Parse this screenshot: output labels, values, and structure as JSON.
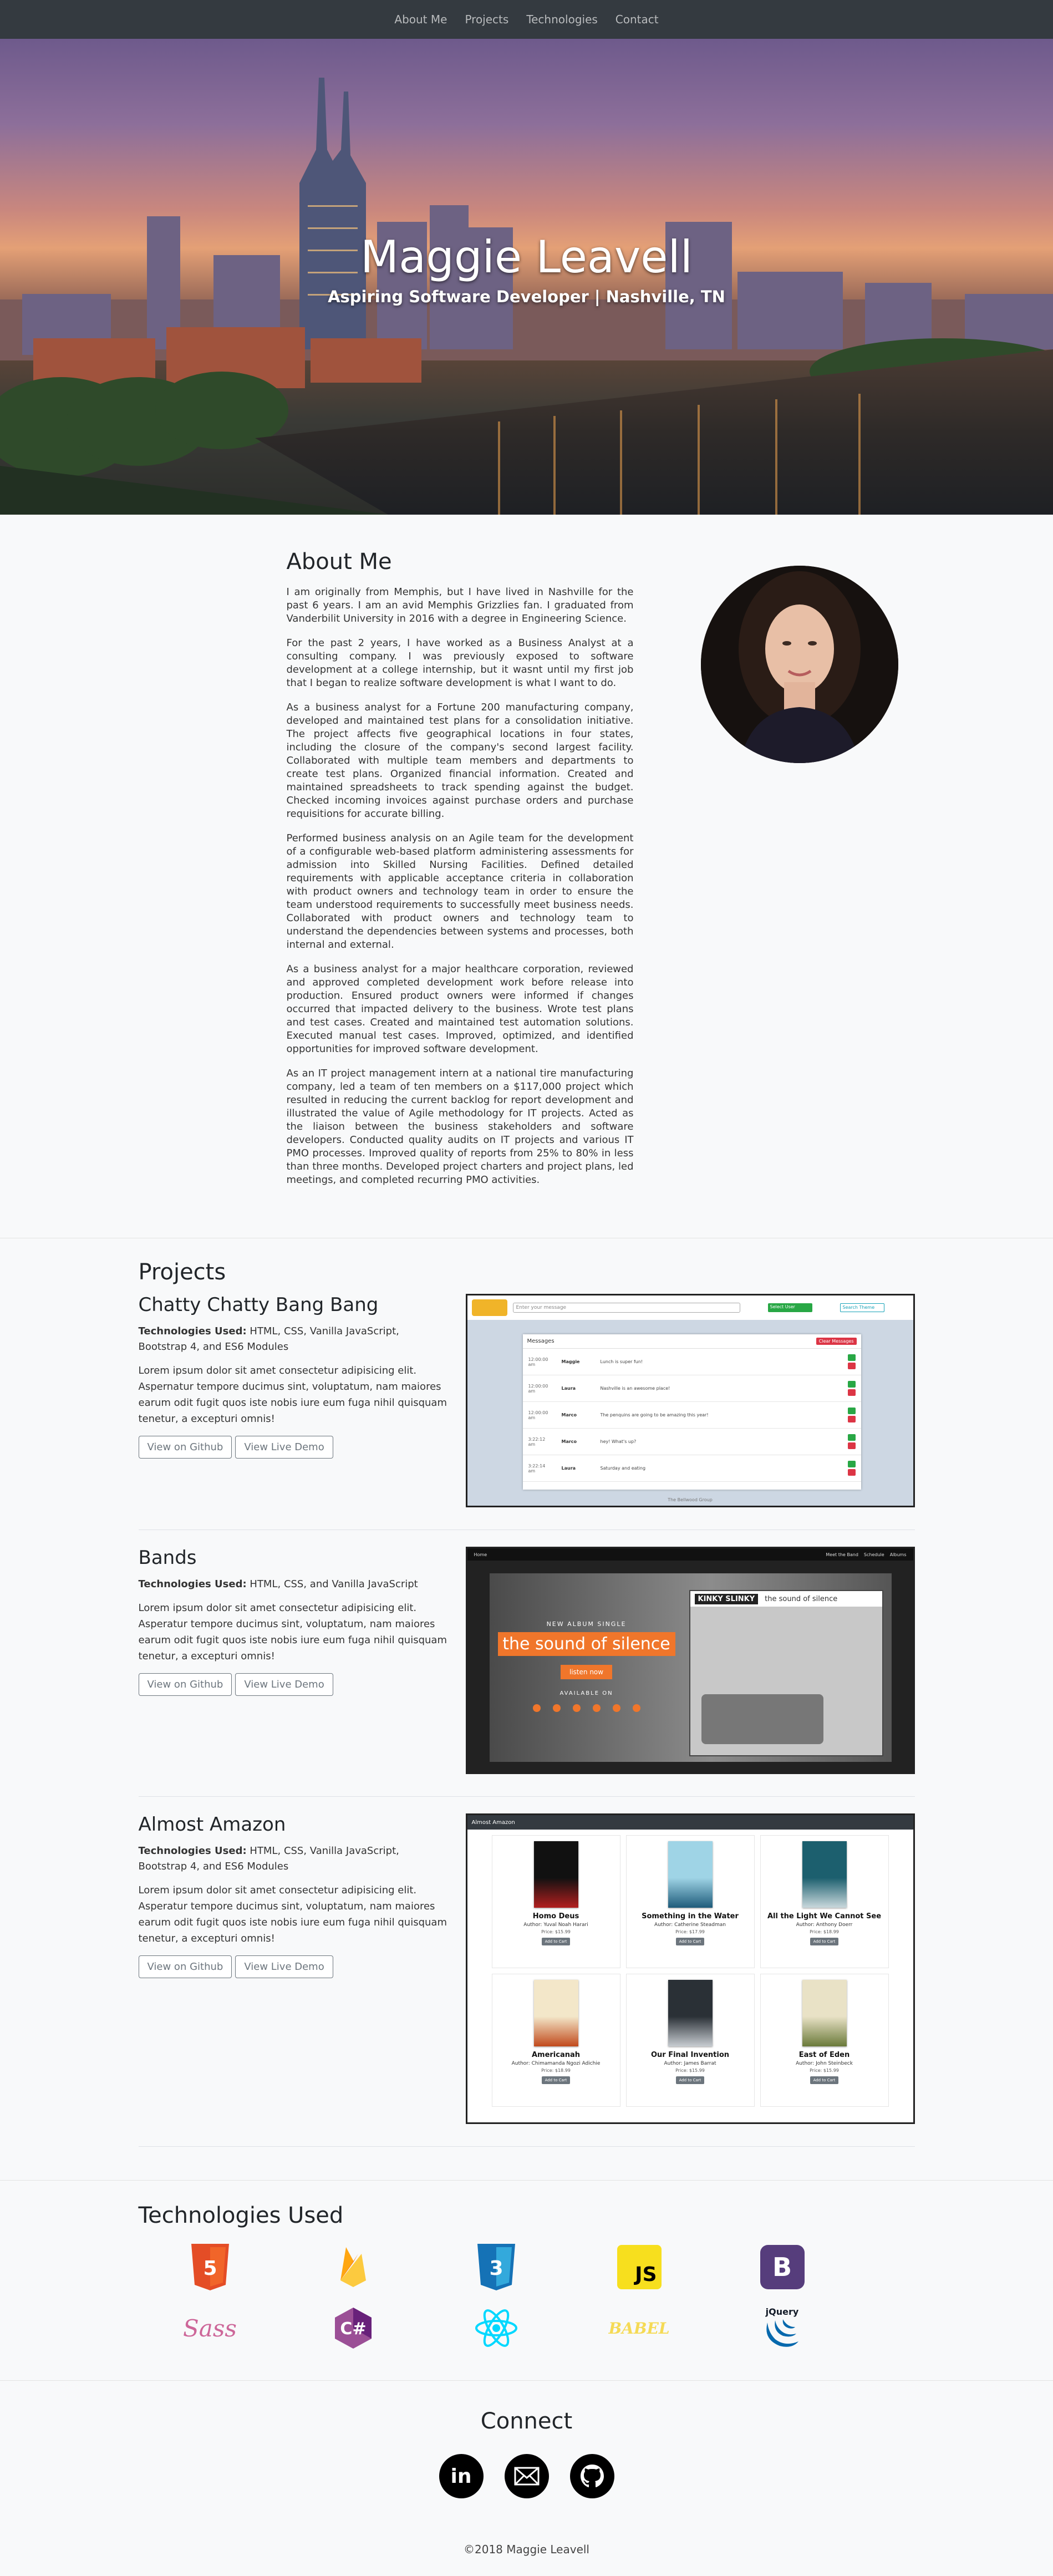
{
  "nav": {
    "items": [
      "About Me",
      "Projects",
      "Technologies",
      "Contact"
    ]
  },
  "hero": {
    "title": "Maggie Leavell",
    "subtitle": "Aspiring Software Developer | Nashville, TN"
  },
  "about": {
    "heading": "About Me",
    "paragraphs": [
      "I am originally from Memphis, but I have lived in Nashville for the past 6 years. I am an avid Memphis Grizzlies fan. I graduated from Vanderbilit University in 2016 with a degree in Engineering Science.",
      "For the past 2 years, I have worked as a Business Analyst at a consulting company. I was previously exposed to software development at a college internship, but it wasnt until my first job that I began to realize software development is what I want to do.",
      "As a business analyst for a Fortune 200 manufacturing company, developed and maintained test plans for a consolidation initiative. The project affects five geographical locations in four states, including the closure of the company's second largest facility. Collaborated with multiple team members and departments to create test plans. Organized financial information. Created and maintained spreadsheets to track spending against the budget. Checked incoming invoices against purchase orders and purchase requisitions for accurate billing.",
      "Performed business analysis on an Agile team for the development of a configurable web-based platform administering assessments for admission into Skilled Nursing Facilities. Defined detailed requirements with applicable acceptance criteria in collaboration with product owners and technology team in order to ensure the team understood requirements to successfully meet business needs. Collaborated with product owners and technology team to understand the dependencies between systems and processes, both internal and external.",
      "As a business analyst for a major healthcare corporation, reviewed and approved completed development work before release into production. Ensured product owners were informed if changes occurred that impacted delivery to the business. Wrote test plans and test cases. Created and maintained test automation solutions. Executed manual test cases. Improved, optimized, and identified opportunities for improved software development.",
      "As an IT project management intern at a national tire manufacturing company, led a team of ten members on a $117,000 project which resulted in reducing the current backlog for report development and illustrated the value of Agile methodology for IT projects. Acted as the liaison between the business stakeholders and software developers. Conducted quality audits on IT projects and various IT PMO processes. Improved quality of reports from 25% to 80% in less than three months. Developed project charters and project plans, led meetings, and completed recurring PMO activities."
    ]
  },
  "projects": {
    "heading": "Projects",
    "tech_label": "Technologies Used:",
    "items": [
      {
        "name": "Chatty Chatty Bang Bang",
        "tech": "HTML, CSS, Vanilla JavaScript, Bootstrap 4, and ES6 Modules",
        "desc": "Lorem ipsum dolor sit amet consectetur adipisicing elit. Aspernatur tempore ducimus sint, voluptatum, nam maiores earum odit fugit quos iste nobis iure eum fuga nihil quisquam tenetur, a excepturi omnis!",
        "github": "View on Github",
        "demo": "View Live Demo"
      },
      {
        "name": "Bands",
        "tech": "HTML, CSS, and Vanilla JavaScript",
        "desc": "Lorem ipsum dolor sit amet consectetur adipisicing elit. Asperatur tempore ducimus sint, voluptatum, nam maiores earum odit fugit quos iste nobis iure eum fuga nihil quisquam tenetur, a excepturi omnis!",
        "github": "View on Github",
        "demo": "View Live Demo"
      },
      {
        "name": "Almost Amazon",
        "tech": "HTML, CSS, Vanilla JavaScript, Bootstrap 4, and ES6 Modules",
        "desc": "Lorem ipsum dolor sit amet consectetur adipisicing elit. Asperatur tempore ducimus sint, voluptatum, nam maiores earum odit fugit quos iste nobis iure eum fuga nihil quisquam tenetur, a excepturi omnis!",
        "github": "View on Github",
        "demo": "View Live Demo"
      }
    ],
    "chatty": {
      "input_placeholder": "Enter your message",
      "select_user": "Select User",
      "search_label": "Search Theme",
      "messages_title": "Messages",
      "clear_label": "Clear Messages",
      "rows": [
        {
          "time": "12:00:00 am",
          "user": "Maggie",
          "text": "Lunch is super fun!"
        },
        {
          "time": "12:00:00 am",
          "user": "Laura",
          "text": "Nashville is an awesome place!"
        },
        {
          "time": "12:00:00 am",
          "user": "Marco",
          "text": "The penquins are going to be amazing this year!"
        },
        {
          "time": "3:22:12 am",
          "user": "Marco",
          "text": "hey! What's up?"
        },
        {
          "time": "3:22:14 am",
          "user": "Laura",
          "text": "Saturday and eating"
        }
      ],
      "footer": "The Bellwood Group"
    },
    "bands": {
      "nav_left": "Home",
      "nav_right": [
        "Meet the Band",
        "Schedule",
        "Albums"
      ],
      "kicker": "NEW ALBUM SINGLE",
      "album": "the sound of silence",
      "listen": "listen now",
      "available": "AVAILABLE ON",
      "band": "KINKY SLINKY",
      "band_album": "the sound of silence"
    },
    "amazon": {
      "brand": "Almost Amazon",
      "books": [
        {
          "title": "Homo Deus",
          "author": "Author: Yuval Noah Harari",
          "price": "Price: $15.99",
          "cover": "#111",
          "cover2": "#b21f1f"
        },
        {
          "title": "Something in the Water",
          "author": "Author: Catherine Steadman",
          "price": "Price: $17.99",
          "cover": "#9fd4e6",
          "cover2": "#1e5b7a"
        },
        {
          "title": "All the Light We Cannot See",
          "author": "Author: Anthony Doerr",
          "price": "Price: $18.99",
          "cover": "#1c5f6e",
          "cover2": "#c9d8dc"
        },
        {
          "title": "Americanah",
          "author": "Author: Chimamanda Ngozi Adichie",
          "price": "Price: $18.99",
          "cover": "#f3e7c9",
          "cover2": "#c14a1c"
        },
        {
          "title": "Our Final Invention",
          "author": "Author: James Barrat",
          "price": "Price: $15.99",
          "cover": "#2a3036",
          "cover2": "#c7ccd1"
        },
        {
          "title": "East of Eden",
          "author": "Author: John Steinbeck",
          "price": "Price: $15.99",
          "cover": "#e9e2c6",
          "cover2": "#6a7a3a"
        }
      ],
      "button": "Add to Cart"
    }
  },
  "tech": {
    "heading": "Technologies Used",
    "icons": [
      "html5-icon",
      "firebase-icon",
      "css3-icon",
      "javascript-icon",
      "bootstrap-icon",
      "sass-icon",
      "csharp-icon",
      "react-icon",
      "babel-icon",
      "jquery-icon"
    ],
    "js_text": "JS",
    "bootstrap_text": "B",
    "jquery_text": "jQuery",
    "sass_text": "Sass",
    "babel_text": "BABEL",
    "csharp_text": "C#"
  },
  "connect": {
    "heading": "Connect",
    "icons": [
      "linkedin-icon",
      "email-icon",
      "github-icon"
    ],
    "linkedin_text": "in"
  },
  "footer": {
    "text": "©2018 Maggie Leavell"
  },
  "colors": {
    "navbar": "#343a40",
    "html5": "#e44d26",
    "firebase": "#ffa611",
    "css3": "#1572b6",
    "js": "#f7df1e",
    "bootstrap": "#563d7c",
    "sass": "#cd6799",
    "csharp": "#9b4f96",
    "react": "#00d8ff",
    "babel": "#f5da55",
    "jquery": "#0769ad"
  }
}
